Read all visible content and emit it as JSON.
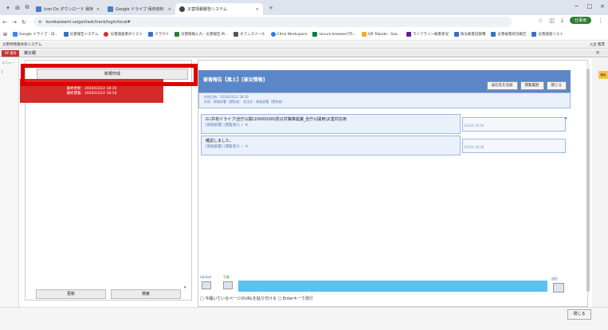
{
  "browser": {
    "tabs": [
      {
        "label": "Icon Dx ダウンロード 保存資料",
        "color": "#4a7bd0"
      },
      {
        "label": "Google ドライブ 保存資料",
        "color": "#4a7bd0"
      },
      {
        "label": "災害情報報告システム",
        "color": "#444"
      }
    ],
    "new_tab": "+",
    "window_controls": [
      "−",
      "□",
      "×"
    ],
    "address": "kurokaokami.saigai/task/track/login/local#",
    "profile_label": "仕事用",
    "bookmarks": [
      "Google ドライブ - 日...",
      "災害報告システム",
      "災害調査者のリスト",
      "クラウド",
      "災害情報入力 - 災害報告 M...",
      "オフィスツール",
      "Citrix Workspace",
      "secure browser(Tf)...",
      "QR Tokudo - Sea...",
      "ライフライン被害状況",
      "防災被害記録簿",
      "災害被害状況報告",
      "災害調査リスト"
    ]
  },
  "app": {
    "title_left": "災害時情報共有システム",
    "title_right": "入出  帳票",
    "dialog_label": "被災報",
    "dialog_close": "×",
    "logo_text": "DP 運用",
    "bg_left_items": [
      "メニュー",
      "F"
    ],
    "bg_right_badge": "報告"
  },
  "left_pane": {
    "new_button": "新規作成",
    "card": {
      "line1": "最終更新：2026/03/22 18:16",
      "line2": "最終閲覧：2026/03/22 18:18"
    },
    "footer_buttons": [
      "更新",
      "検索"
    ],
    "scroll_arrow": "▾"
  },
  "report": {
    "title": "被害報告【風土】[被災情報]",
    "buttons": [
      "返信先を追加",
      "閲覧履歴",
      "閉じる"
    ],
    "meta_line1": "作成日時：2026/03/22 18:16",
    "meta_line2": "作成：情報部署（閲覧者）  担当先：情報部署（閲覧者）",
    "messages": [
      {
        "body": "G:\\共有ドライブ\\全庁公開\\10000200\\防災対策推進課_全庁公開用\\災害対応用",
        "meta": "[情報部署] (閲覧者1) ✓ ※",
        "time": "03/22 18:16"
      },
      {
        "body": "確認しました。",
        "meta": "[情報部署] (閲覧者2) ✓ ※",
        "time": "03/22 18:18"
      }
    ],
    "scroll_arrow": "▴"
  },
  "input_area": {
    "attach_label_1": "Upload",
    "attach_label_2": "写真",
    "send_label": "送信",
    "checkbox_line": "□ 今開いているページのURLを貼り付ける  □ Enterキーで改行"
  },
  "footer": {
    "close_button": "閉じる"
  }
}
